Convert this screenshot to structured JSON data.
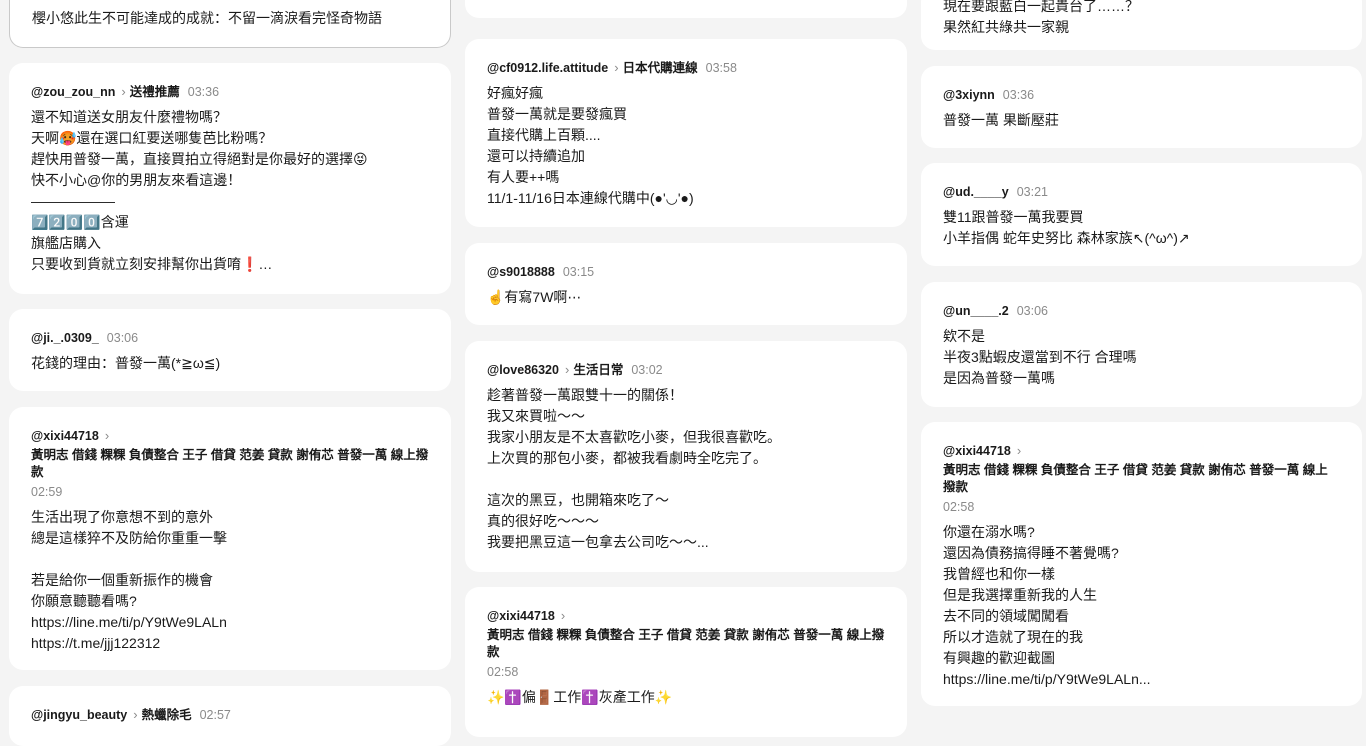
{
  "posts": [
    {
      "user": "",
      "topic": "",
      "time": "",
      "body": "櫻小悠此生不可能達成的成就：不留一滴淚看完怪奇物語"
    },
    {
      "user": "@zou_zou_nn",
      "topic": "送禮推薦",
      "time": "03:36",
      "body": "還不知道送女朋友什麼禮物嗎？\n天啊🥵還在選口紅要送哪隻芭比粉嗎？\n趕快用普發一萬，直接買拍立得絕對是你最好的選擇😝\n快不小心@你的男朋友來看這邊！\n——————\n7️⃣2️⃣0️⃣0️⃣含運\n旗艦店購入\n只要收到貨就立刻安排幫你出貨唷❗…"
    },
    {
      "user": "@ji._.0309_",
      "topic": "",
      "time": "03:06",
      "body": "花錢的理由：普發一萬(*≧ω≦)"
    },
    {
      "user": "@xixi44718",
      "topic": "黃明志 借錢 粿粿 負債整合 王子 借貸 范姜 貸款 謝侑芯 普發一萬 線上撥款",
      "time": "02:59",
      "body": "生活出現了你意想不到的意外\n總是這樣猝不及防給你重重一擊\n\n若是給你一個重新振作的機會\n你願意聽聽看嗎?\nhttps://line.me/ti/p/Y9tWe9LALn\nhttps://t.me/jjj122312"
    },
    {
      "user": "@jingyu_beauty",
      "topic": "熱蠟除毛",
      "time": "02:57",
      "body": ""
    },
    {
      "user": "@cf0912.life.attitude",
      "topic": "日本代購連線",
      "time": "03:58",
      "body": "好瘋好瘋\n普發一萬就是要發瘋買\n直接代購上百顆....\n還可以持續追加\n有人要++嗎\n11/1-11/16日本連線代購中(●'◡'●)"
    },
    {
      "user": "@s9018888",
      "topic": "",
      "time": "03:15",
      "body": "☝️有寫7W啊⋯"
    },
    {
      "user": "@love86320",
      "topic": "生活日常",
      "time": "03:02",
      "body": "趁著普發一萬跟雙十一的關係！\n我又來買啦～～\n我家小朋友是不太喜歡吃小麥，但我很喜歡吃。\n上次買的那包小麥，都被我看劇時全吃完了。\n\n這次的黑豆，也開箱來吃了～\n真的很好吃～～～\n我要把黑豆這一包拿去公司吃～～..."
    },
    {
      "user": "@xixi44718",
      "topic": "黃明志 借錢 粿粿 負債整合 王子 借貸 范姜 貸款 謝侑芯 普發一萬 線上撥款",
      "time": "02:58",
      "body": "✨✝️偏🚪工作✝️灰產工作✨"
    },
    {
      "user": "",
      "topic": "",
      "time": "",
      "body": "現在要跟藍白一起貴台了……？\n果然紅共綠共一家親"
    },
    {
      "user": "@3xiynn",
      "topic": "",
      "time": "03:36",
      "body": "普發一萬 果斷壓莊"
    },
    {
      "user": "@ud.____y",
      "topic": "",
      "time": "03:21",
      "body": "雙11跟普發一萬我要買\n小羊指偶 蛇年史努比 森林家族↖(^ω^)↗"
    },
    {
      "user": "@un____.2",
      "topic": "",
      "time": "03:06",
      "body": "欸不是\n半夜3點蝦皮還當到不行 合理嗎\n是因為普發一萬嗎"
    },
    {
      "user": "@xixi44718",
      "topic": "黃明志 借錢 粿粿 負債整合 王子 借貸 范姜 貸款 謝侑芯 普發一萬 線上撥款",
      "time": "02:58",
      "body": "你還在溺水嗎?\n還因為債務搞得睡不著覺嗎?\n我曾經也和你一樣\n但是我選擇重新我的人生\n去不同的領域闖闖看\n所以才造就了現在的我\n有興趣的歡迎截圖\nhttps://line.me/ti/p/Y9tWe9LALn..."
    }
  ]
}
